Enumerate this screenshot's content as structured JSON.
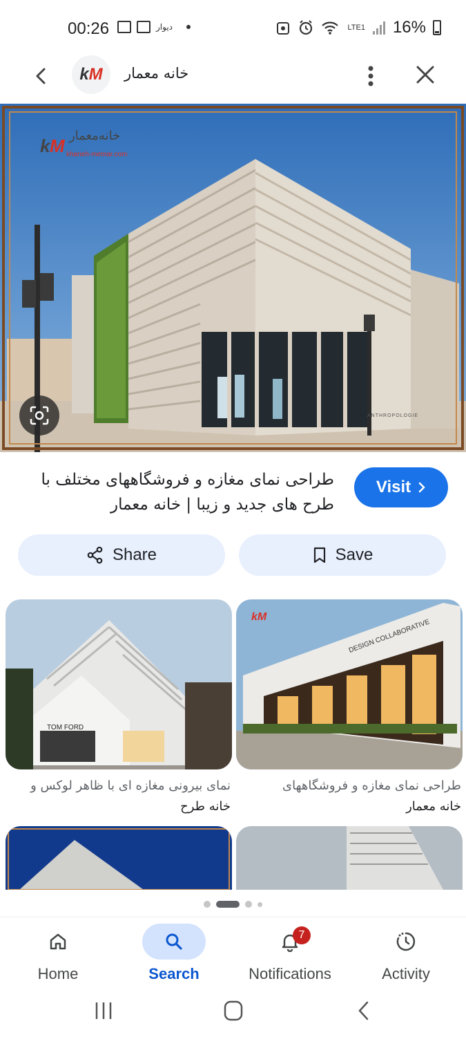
{
  "status_bar": {
    "time": "00:26",
    "app_label": "دیوار",
    "network": "LTE1",
    "battery": "16%"
  },
  "header": {
    "site_name": "خانه معمار",
    "logo_text_k": "k",
    "logo_text_m": "M"
  },
  "pin": {
    "title": "طراحی نمای مغازه و فروشگاههای مختلف با طرح های جدید و زیبا | خانه معمار",
    "visit_label": "Visit",
    "hero_watermark": "خانه‌معمار",
    "hero_watermark_url": "khaneh-memar.com",
    "store_sign": "ANTHROPOLOGIE"
  },
  "actions": {
    "share_label": "Share",
    "save_label": "Save"
  },
  "grid": [
    {
      "caption": "نمای بیرونی مغازه ای با ظاهر لوکس و",
      "source": "خانه طرح",
      "sign": "TOM FORD"
    },
    {
      "caption": "طراحی نمای مغازه و فروشگاههای",
      "source": "خانه معمار",
      "sign": "DESIGN COLLABORATIVE"
    }
  ],
  "bottom_nav": {
    "items": [
      {
        "label": "Home"
      },
      {
        "label": "Search"
      },
      {
        "label": "Notifications",
        "badge": "7"
      },
      {
        "label": "Activity"
      }
    ],
    "active": "Search"
  },
  "colors": {
    "accent": "#1a73e8",
    "pill": "#e8f0fe",
    "active_nav": "#d3e3fd",
    "badge": "#c5221f"
  }
}
